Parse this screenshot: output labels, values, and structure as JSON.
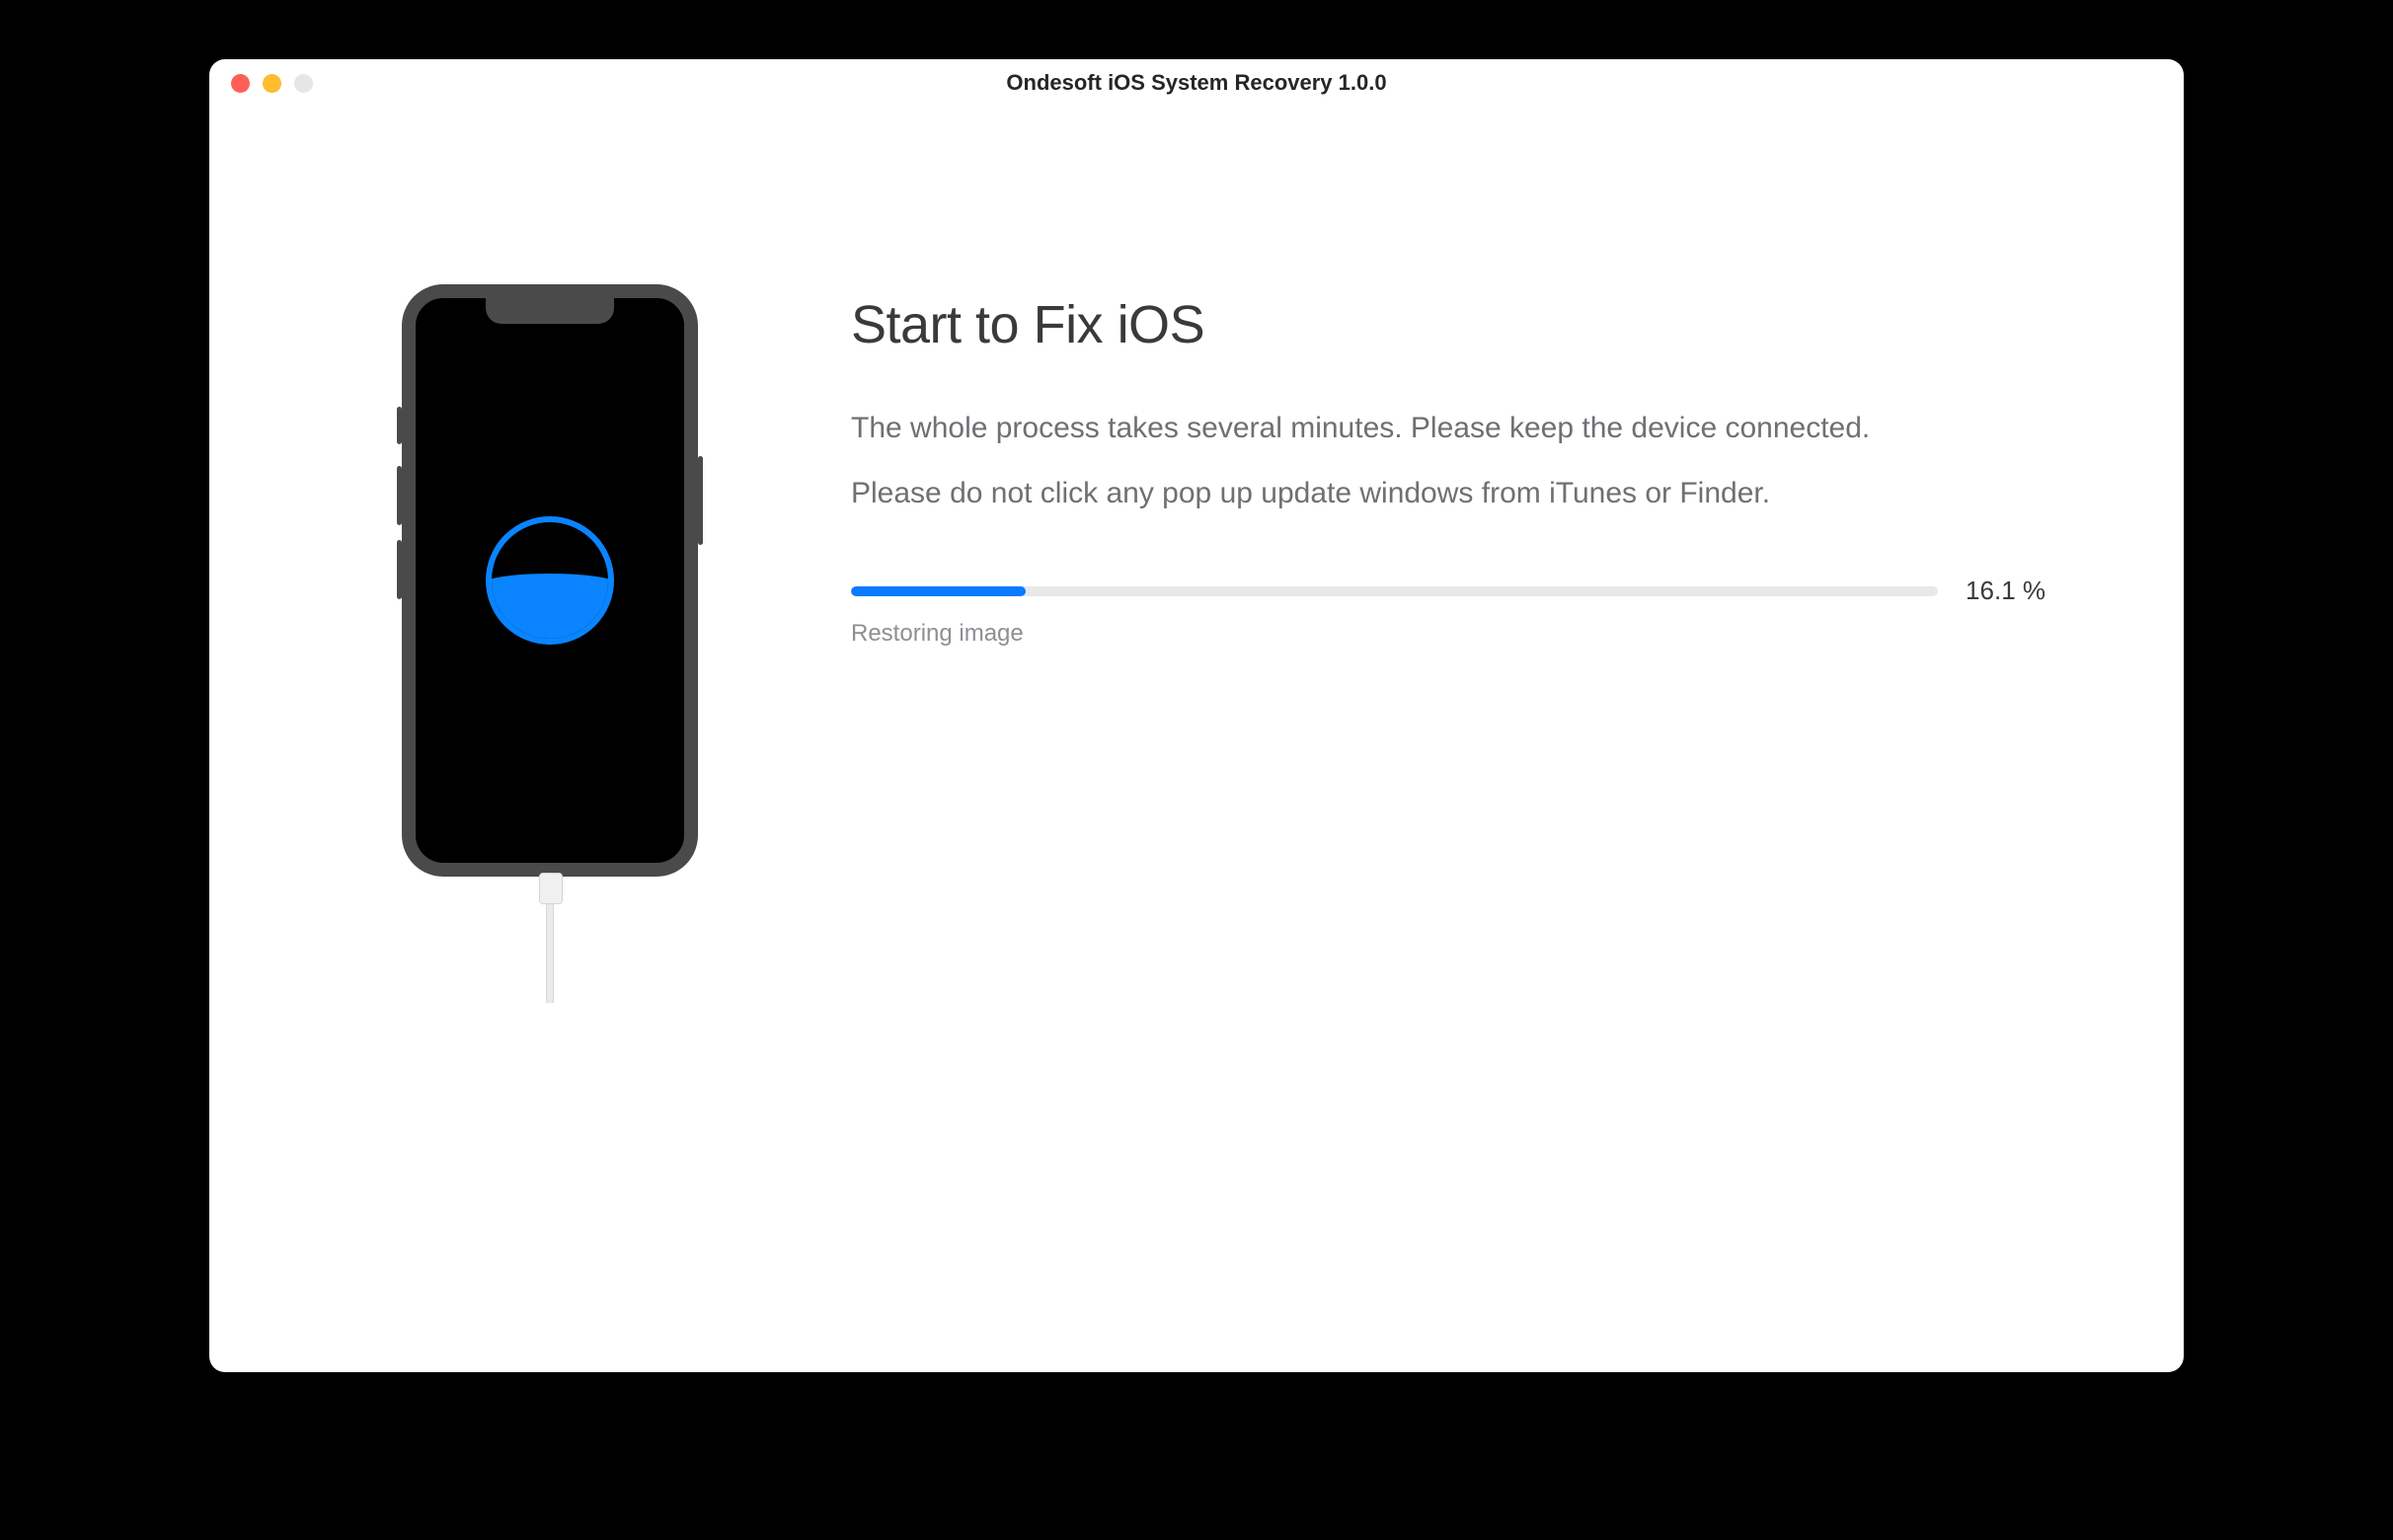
{
  "window": {
    "title": "Ondesoft iOS System Recovery 1.0.0"
  },
  "main": {
    "heading": "Start to Fix iOS",
    "description1": "The whole process takes several minutes. Please keep the device connected.",
    "description2": "Please do not click any pop up update windows from iTunes or Finder."
  },
  "progress": {
    "percent_value": 16.1,
    "percent_label": "16.1 %",
    "status": "Restoring image"
  },
  "colors": {
    "accent": "#0a7aff"
  }
}
